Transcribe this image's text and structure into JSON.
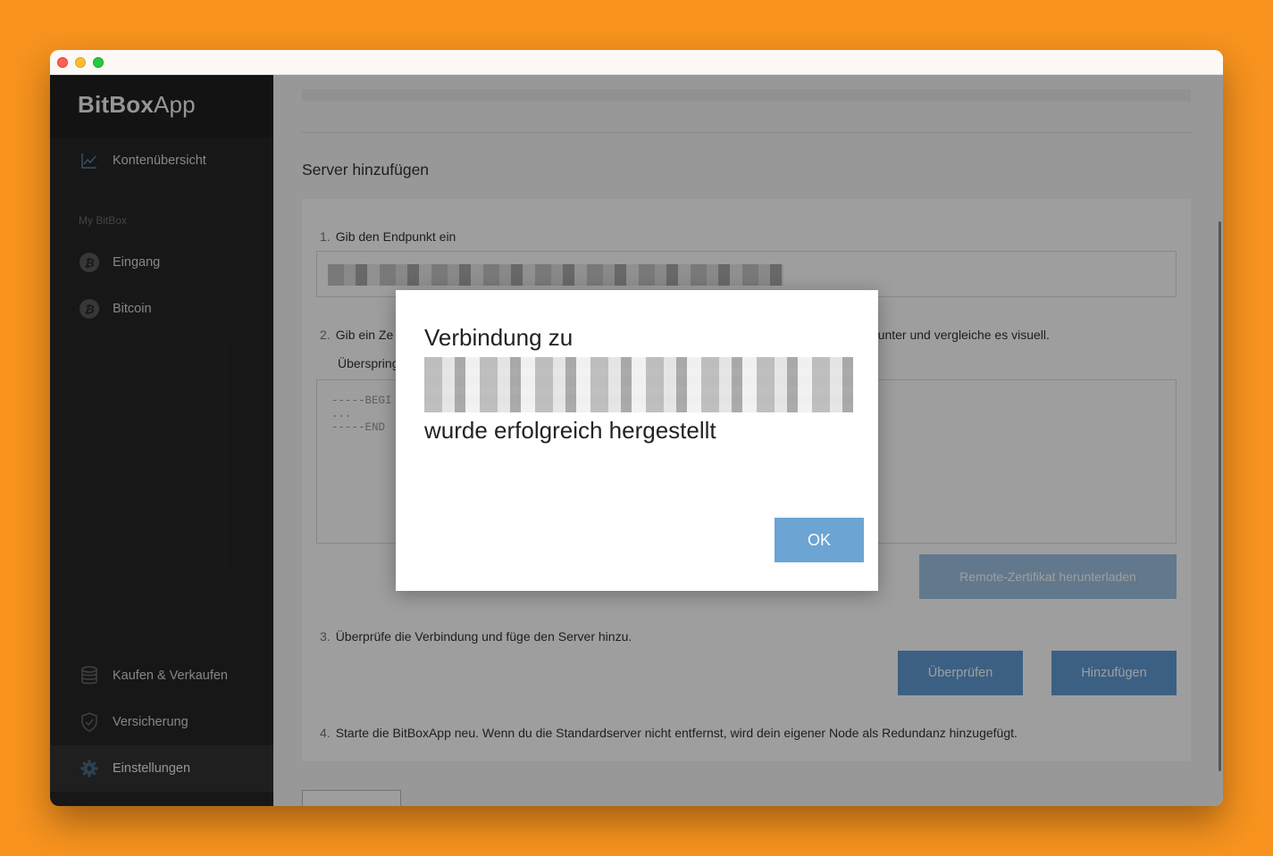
{
  "app": {
    "brand_bold": "BitBox",
    "brand_light": "App"
  },
  "sidebar": {
    "overview": "Kontenübersicht",
    "section_label": "My BitBox",
    "accounts": [
      {
        "label": "Eingang",
        "icon": "bitcoin-coin-icon"
      },
      {
        "label": "Bitcoin",
        "icon": "bitcoin-coin-icon"
      }
    ],
    "bottom": [
      {
        "label": "Kaufen & Verkaufen",
        "icon": "coins-stack-icon"
      },
      {
        "label": "Versicherung",
        "icon": "shield-check-icon"
      },
      {
        "label": "Einstellungen",
        "icon": "gear-icon",
        "active": true
      }
    ]
  },
  "main": {
    "title": "Server hinzufügen",
    "step1_num": "1.",
    "step1": "Gib den Endpunkt ein",
    "step2_num": "2.",
    "step2_start": "Gib ein Ze",
    "step2_end": "runter und vergleiche es visuell.",
    "skip": "Überspring",
    "cert_placeholder": "-----BEGI\n...\n-----END",
    "download_btn": "Remote-Zertifikat herunterladen",
    "step3_num": "3.",
    "step3": "Überprüfe die Verbindung und füge den Server hinzu.",
    "check_btn": "Überprüfen",
    "add_btn": "Hinzufügen",
    "step4_num": "4.",
    "step4": "Starte die BitBoxApp neu. Wenn du die Standardserver nicht entfernst, wird dein eigener Node als Redundanz hinzugefügt."
  },
  "dialog": {
    "line1": "Verbindung zu",
    "line_final": "wurde erfolgreich hergestellt",
    "ok": "OK"
  },
  "colors": {
    "background": "#f7931e",
    "sidebar": "#262626",
    "primary": "#5f9cd6"
  }
}
